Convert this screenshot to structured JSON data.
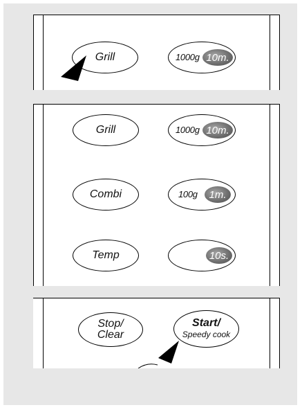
{
  "panel_top": {
    "grill_button": "Grill",
    "weight_button": {
      "weight": "1000g",
      "time": "10m."
    }
  },
  "panel_middle": {
    "grill_button": "Grill",
    "grill_value": {
      "weight": "1000g",
      "time": "10m."
    },
    "combi_button": "Combi",
    "combi_value": {
      "weight": "100g",
      "time": "1m."
    },
    "temp_button": "Temp",
    "temp_value": {
      "time": "10s."
    }
  },
  "panel_bottom": {
    "stop_button": {
      "line1": "Stop/",
      "line2": "Clear"
    },
    "start_button": {
      "line1": "Start/",
      "line2": "Speedy cook"
    }
  },
  "colors": {
    "background": "#e7e7e7",
    "dial": "#6e6e6e",
    "panel": "#ffffff"
  },
  "icons": [
    "pointer-arrow-icon"
  ]
}
